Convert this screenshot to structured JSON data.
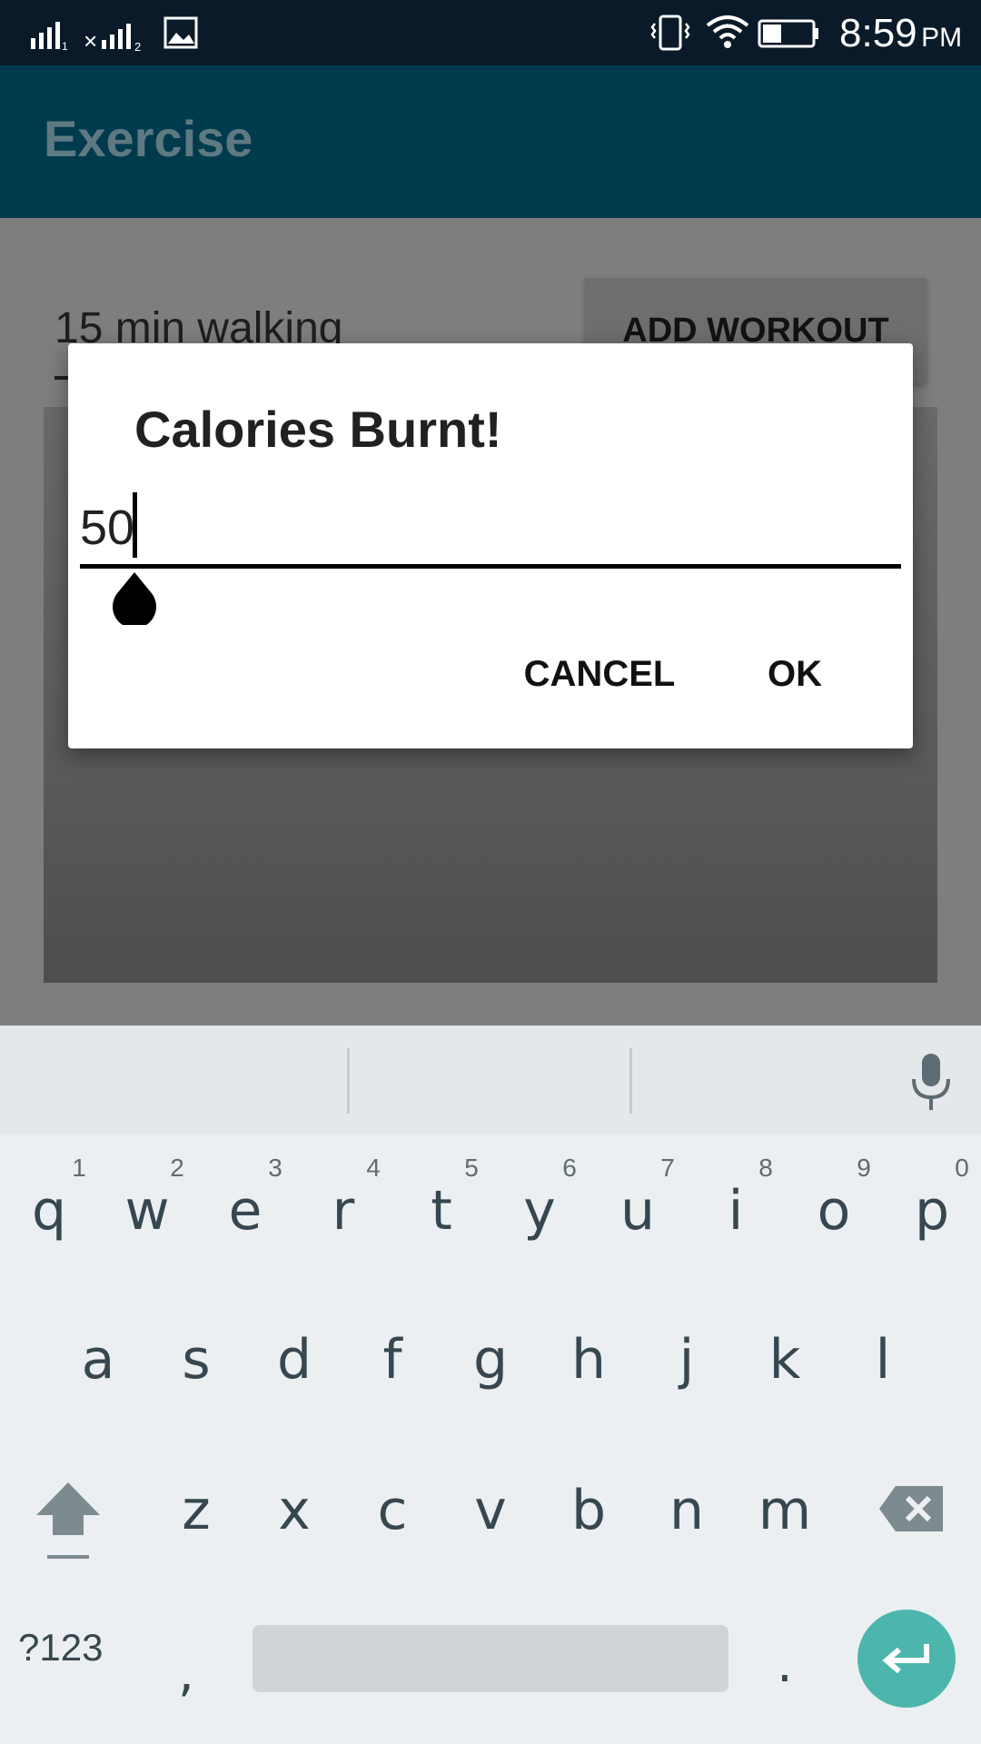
{
  "status_bar": {
    "time": "8:59",
    "ampm": "PM"
  },
  "app_bar": {
    "title": "Exercise"
  },
  "main": {
    "workout_input_value": "15 min walking",
    "add_workout_label": "ADD WORKOUT"
  },
  "dialog": {
    "title": "Calories Burnt!",
    "input_value": "50",
    "cancel_label": "CANCEL",
    "ok_label": "OK"
  },
  "keyboard": {
    "row1": [
      {
        "key": "q",
        "hint": "1"
      },
      {
        "key": "w",
        "hint": "2"
      },
      {
        "key": "e",
        "hint": "3"
      },
      {
        "key": "r",
        "hint": "4"
      },
      {
        "key": "t",
        "hint": "5"
      },
      {
        "key": "y",
        "hint": "6"
      },
      {
        "key": "u",
        "hint": "7"
      },
      {
        "key": "i",
        "hint": "8"
      },
      {
        "key": "o",
        "hint": "9"
      },
      {
        "key": "p",
        "hint": "0"
      }
    ],
    "row2": [
      "a",
      "s",
      "d",
      "f",
      "g",
      "h",
      "j",
      "k",
      "l"
    ],
    "row3": [
      "z",
      "x",
      "c",
      "v",
      "b",
      "n",
      "m"
    ],
    "symbols_label": "?123",
    "comma": ",",
    "period": "."
  },
  "colors": {
    "app_bar": "#003a4d",
    "status_bar": "#0a1a29",
    "enter_key": "#4db6ac",
    "keyboard_bg": "#eceff1"
  },
  "icons": {
    "status_left": [
      "signal-1-icon",
      "signal-2-no-data-icon",
      "image-notification-icon"
    ],
    "status_right": [
      "vibrate-icon",
      "wifi-icon",
      "battery-icon"
    ],
    "keyboard": [
      "mic-icon",
      "shift-icon",
      "backspace-icon",
      "enter-icon"
    ]
  }
}
